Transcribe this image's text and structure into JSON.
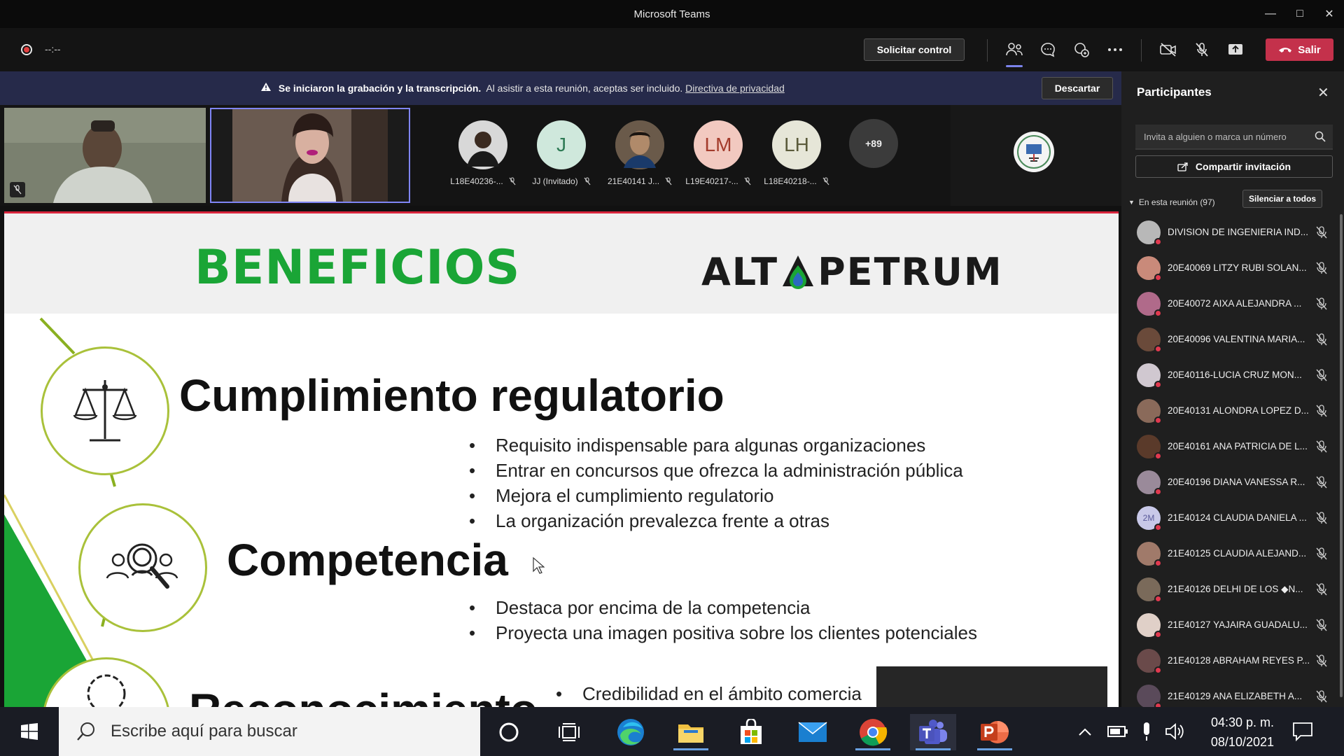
{
  "window": {
    "title": "Microsoft Teams"
  },
  "toolbar": {
    "timer": "--:--",
    "request_control_label": "Solicitar control",
    "leave_label": "Salir",
    "icons": [
      "people-icon",
      "chat-icon",
      "reactions-icon",
      "more-icon",
      "camera-off-icon",
      "mic-off-icon",
      "share-tray-icon"
    ]
  },
  "banner": {
    "bold_text": "Se iniciaron la grabación y la transcripción.",
    "text": "Al asistir a esta reunión, aceptas ser incluido.",
    "link": "Directiva de privacidad",
    "dismiss_label": "Descartar"
  },
  "gallery": {
    "avatars": [
      {
        "name": "L18E40236-...",
        "initials": "",
        "color": "#3a3a3a"
      },
      {
        "name": "JJ (Invitado)",
        "initials": "J",
        "color": "#cfe8dc",
        "text_color": "#2e7a55"
      },
      {
        "name": "21E40141 J...",
        "initials": "",
        "color": "#4a4035"
      },
      {
        "name": "L19E40217-...",
        "initials": "LM",
        "color": "#f2c9c0",
        "text_color": "#a33b2b"
      },
      {
        "name": "L18E40218-...",
        "initials": "LH",
        "color": "#e6e6d8",
        "text_color": "#5a5a3a"
      }
    ],
    "overflow": "+89"
  },
  "slide": {
    "title": "BENEFICIOS",
    "logo_left": "ALT",
    "logo_right": "PETRUM",
    "sections": [
      {
        "title": "Cumplimiento regulatorio",
        "bullets": [
          "Requisito indispensable para algunas organizaciones",
          "Entrar en concursos que ofrezca la administración pública",
          "Mejora el cumplimiento regulatorio",
          "La organización prevalezca frente a otras"
        ]
      },
      {
        "title": "Competencia",
        "bullets": [
          "Destaca por encima de la competencia",
          "Proyecta una imagen positiva sobre los clientes potenciales"
        ]
      },
      {
        "title": "Reconocimiento",
        "bullets": [
          "Credibilidad en el ámbito comercia"
        ]
      }
    ]
  },
  "panel": {
    "title": "Participantes",
    "invite_placeholder": "Invita a alguien o marca un número",
    "share_label": "Compartir invitación",
    "in_meeting_label": "En esta reunión (97)",
    "mute_all_label": "Silenciar a todos",
    "participants": [
      {
        "name": "DIVISION DE INGENIERIA IND...",
        "color": "#b8b8b8",
        "initials": ""
      },
      {
        "name": "20E40069 LITZY RUBI SOLAN...",
        "color": "#c98a7a",
        "initials": ""
      },
      {
        "name": "20E40072 AIXA ALEJANDRA ...",
        "color": "#b06a8a",
        "initials": ""
      },
      {
        "name": "20E40096 VALENTINA MARIA...",
        "color": "#6a4a3a",
        "initials": ""
      },
      {
        "name": "20E40116-LUCIA CRUZ MON...",
        "color": "#d0c8d0",
        "initials": ""
      },
      {
        "name": "20E40131 ALONDRA LOPEZ D...",
        "color": "#8a6a5a",
        "initials": ""
      },
      {
        "name": "20E40161 ANA PATRICIA DE L...",
        "color": "#5a3a2a",
        "initials": ""
      },
      {
        "name": "20E40196 DIANA VANESSA R...",
        "color": "#9a8a9a",
        "initials": ""
      },
      {
        "name": "21E40124 CLAUDIA DANIELA ...",
        "color": "#c8c8e8",
        "initials": "2M",
        "text_color": "#5a5a9a"
      },
      {
        "name": "21E40125 CLAUDIA ALEJAND...",
        "color": "#a07a6a",
        "initials": ""
      },
      {
        "name": "21E40126 DELHI DE LOS ◆N...",
        "color": "#7a6a5a",
        "initials": ""
      },
      {
        "name": "21E40127 YAJAIRA GUADALU...",
        "color": "#e0d0c8",
        "initials": ""
      },
      {
        "name": "21E40128 ABRAHAM REYES P...",
        "color": "#6a4a4a",
        "initials": ""
      },
      {
        "name": "21E40129 ANA ELIZABETH A...",
        "color": "#5a4a5a",
        "initials": ""
      }
    ]
  },
  "taskbar": {
    "search_placeholder": "Escribe aquí para buscar",
    "time": "04:30 p. m.",
    "date": "08/10/2021",
    "apps": [
      "cortana-icon",
      "task-view-icon",
      "edge-icon",
      "file-explorer-icon",
      "store-icon",
      "mail-icon",
      "chrome-icon",
      "teams-icon",
      "powerpoint-icon"
    ]
  },
  "colors": {
    "accent_red": "#c4314b",
    "banner_bg": "#262a4a",
    "slide_green": "#1aa536",
    "circle_green": "#a9c13a"
  }
}
